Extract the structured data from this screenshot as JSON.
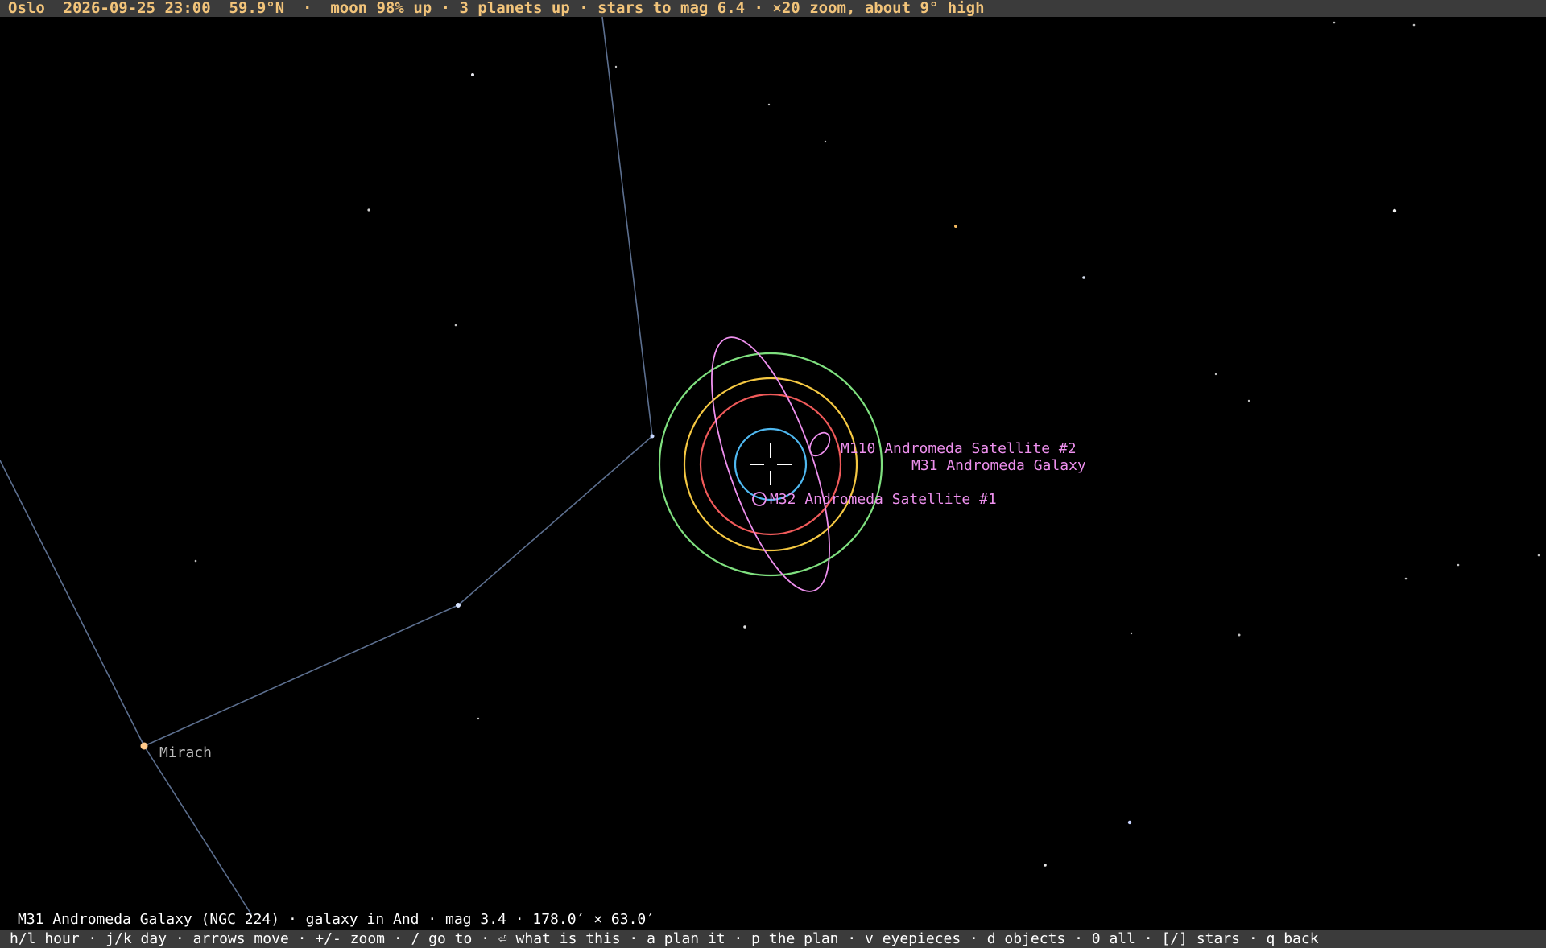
{
  "status_bar": {
    "text": "Oslo  2026-09-25 23:00  59.9°N  ·  moon 98% up · 3 planets up · stars to mag 6.4 · ×20 zoom, about 9° high",
    "color": "#f2c47a"
  },
  "sky": {
    "labels": {
      "mirach": "Mirach",
      "m110": "M110 Andromeda Satellite #2",
      "m31": "M31 Andromeda Galaxy",
      "m32": "M32 Andromeda Satellite #1"
    },
    "eyepiece_ring_colors": [
      "#7fe07f",
      "#f5c842",
      "#f05a5a",
      "#4fb8f0"
    ],
    "galaxy_outline_color": "#ee90ee",
    "constellation_line_color": "#5c6f8f"
  },
  "selected_object": {
    "text": "M31 Andromeda Galaxy (NGC 224) · galaxy in And · mag 3.4 · 178.0′ × 63.0′"
  },
  "help_bar": {
    "text": "h/l hour · j/k day · arrows move · +/- zoom · / go to · ⏎ what is this · a plan it · p the plan · v eyepieces · d objects · 0 all · [/] stars · q back"
  }
}
